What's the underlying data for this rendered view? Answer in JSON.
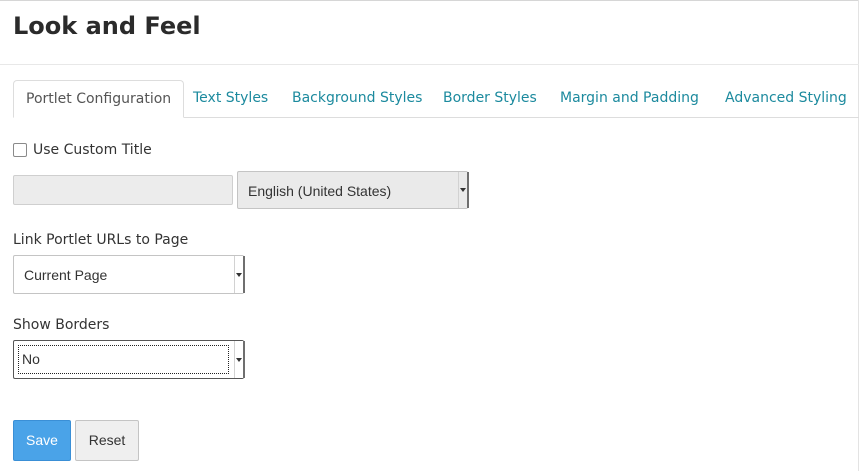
{
  "page": {
    "title": "Look and Feel"
  },
  "tabs": [
    {
      "label": "Portlet Configuration",
      "active": true
    },
    {
      "label": "Text Styles",
      "active": false
    },
    {
      "label": "Background Styles",
      "active": false
    },
    {
      "label": "Border Styles",
      "active": false
    },
    {
      "label": "Margin and Padding",
      "active": false
    },
    {
      "label": "Advanced Styling",
      "active": false
    }
  ],
  "form": {
    "use_custom_title": {
      "label": "Use Custom Title",
      "checked": false
    },
    "custom_title_input": {
      "value": ""
    },
    "language_select": {
      "value": "English (United States)"
    },
    "link_urls": {
      "label": "Link Portlet URLs to Page",
      "value": "Current Page"
    },
    "show_borders": {
      "label": "Show Borders",
      "value": "No"
    }
  },
  "buttons": {
    "save": "Save",
    "reset": "Reset"
  },
  "colors": {
    "link": "#1c8a9e",
    "primary": "#4aa3e8"
  }
}
